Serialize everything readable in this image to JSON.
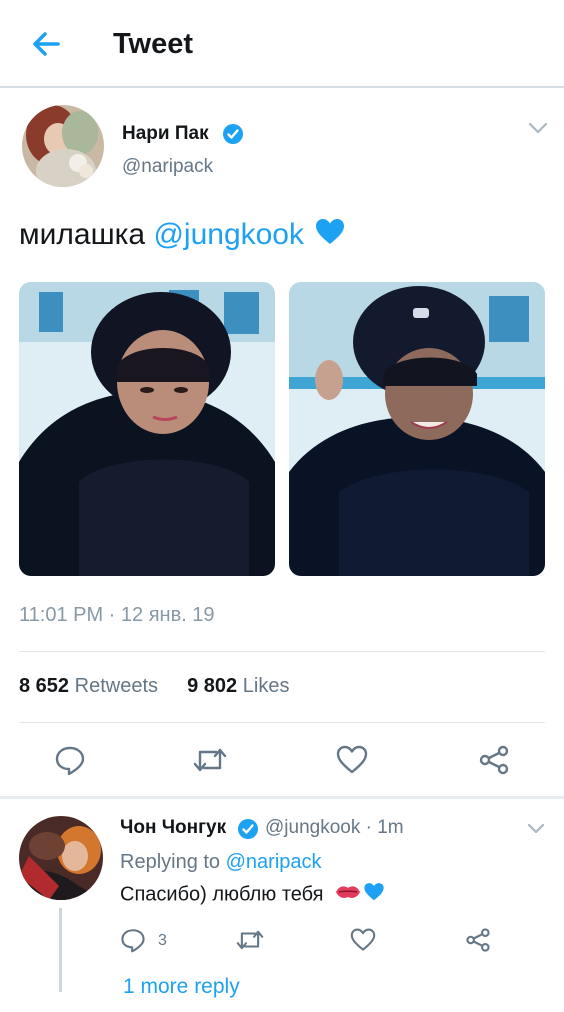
{
  "header": {
    "title": "Tweet"
  },
  "tweet": {
    "author_name": "Нари Пак",
    "author_handle": "@naripack",
    "text_plain": "милашка ",
    "text_mention": "@jungkook",
    "timestamp": "11:01 PM · 12 янв. 19",
    "retweets_count": "8 652",
    "retweets_label": "Retweets",
    "likes_count": "9 802",
    "likes_label": "Likes"
  },
  "reply": {
    "author_name": "Чон Чонгук",
    "meta": "@jungkook · 1m",
    "replying_prefix": "Replying to ",
    "replying_handle": "@naripack",
    "text": "Спасибо) люблю тебя",
    "reply_count": "3",
    "more_replies": "1 more reply"
  },
  "colors": {
    "accent": "#1da1f2",
    "text": "#14171a",
    "muted": "#657786"
  }
}
